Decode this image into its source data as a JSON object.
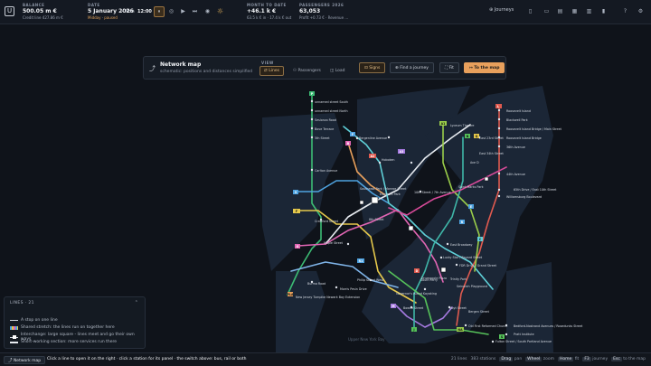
{
  "topbar": {
    "logo": "U",
    "balance": {
      "caption": "BALANCE",
      "value": "500.05 m €",
      "sub": "Credit line 427.86 m €"
    },
    "date": {
      "caption": "DATE",
      "value": "5 January 2026",
      "dash": "–",
      "day": "Mon",
      "time": "12:00",
      "period": "Midday",
      "status": "paused"
    },
    "controls": {
      "pause": "⏸",
      "slow": "◎",
      "play": "▶",
      "fast": "⏭",
      "fastest": "◉",
      "weather": "☼"
    },
    "month": {
      "caption": "MONTH TO DATE",
      "value": "+46.1 k €",
      "in": "63.5 k € in",
      "out": "17.4 k € out"
    },
    "passengers": {
      "caption": "PASSENGERS 2026",
      "value": "63,053",
      "profit": "Profit +0.73 €",
      "revenue": "Revenue …"
    },
    "journeys_label": "Journeys"
  },
  "panel": {
    "title": "Network map",
    "subtitle": "schematic: positions and distances simplified",
    "view_caption": "VIEW",
    "views": [
      "Lines",
      "Passengers",
      "Load"
    ],
    "active_view": "Lines",
    "signs_label": "Signs",
    "find_label": "Find a journey",
    "fit_label": "Fit",
    "to_map_label": "To the map"
  },
  "lines_panel": {
    "title": "LINES",
    "count": "21",
    "legend": [
      "A stop on one line",
      "Shared stretch: the lines run on together here",
      "Interchange: large square - lines meet and go their own ways",
      "Short-working section: more services run there"
    ]
  },
  "map": {
    "water_label": "Upper New York Bay",
    "stations": [
      "unnamed street South",
      "unnamed street North",
      "Sesionzo Road",
      "Bove Terrace",
      "5th Street",
      "Bergenline Avenue",
      "Hoboken",
      "Carlton Avenue",
      "Southeast Park / Monroe Street",
      "Elephant Park",
      "Crawford Street",
      "8th Street",
      "Maple Street",
      "Burma Road",
      "Morris Pesin Drive",
      "New Jersey Turnpike Newark Bay Extension",
      "Philip Street West",
      "Lyceum Theatre",
      "East 34th Street",
      "Ave D",
      "East 23rd Street",
      "10th Street / 7th Avenue",
      "Saint Marks Park",
      "East Broadway",
      "Lucky Star / Bayard Street",
      "FDR Drive / Grand Street",
      "Drumgoole Plaza",
      "Trinity Park",
      "Seinwich Playground",
      "South Ferry",
      "Governor's Island Kayaking",
      "Bowne Street",
      "Hoyt Street",
      "Bergen Street",
      "Old First Reformed Church",
      "Roosevelt Island",
      "Blackwell Park",
      "Roosevelt Island Bridge / Main Street",
      "Roosevelt Island Bridge",
      "36th Avenue",
      "44th Avenue",
      "65th Drive / East 10th Street",
      "Williamsburg Boulevard",
      "Bedford-Nostrand Avenues / Rosedunks Street",
      "Pratt Institute",
      "Fulton Street / South Portland Avenue"
    ],
    "badges": [
      "P",
      "F",
      "B",
      "5",
      "F",
      "G",
      "PLA",
      "A2",
      "A3",
      "A1",
      "L",
      "N",
      "Q",
      "E",
      "R",
      "C",
      "D",
      "M",
      "J",
      "NA",
      "S",
      "R1"
    ]
  },
  "statusbar": {
    "tag": "Network map",
    "hint_part1": "Click a line to open it on the right",
    "hint_part2": "click a station for its panel",
    "hint_part3": "the switch above: bus, rail or both",
    "lines_count": "21 lines",
    "stations_count": "383 stations",
    "drag": "Drag",
    "drag_action": "pan",
    "wheel": "Wheel",
    "wheel_action": "zoom",
    "home": "Home",
    "home_action": "fit",
    "f3": "F3",
    "f3_action": "journey",
    "esc": "Esc",
    "esc_action": "to the map"
  },
  "colors": {
    "accent": "#e8a05c",
    "map_land": "#1c2838",
    "map_water": "#0f131a"
  }
}
